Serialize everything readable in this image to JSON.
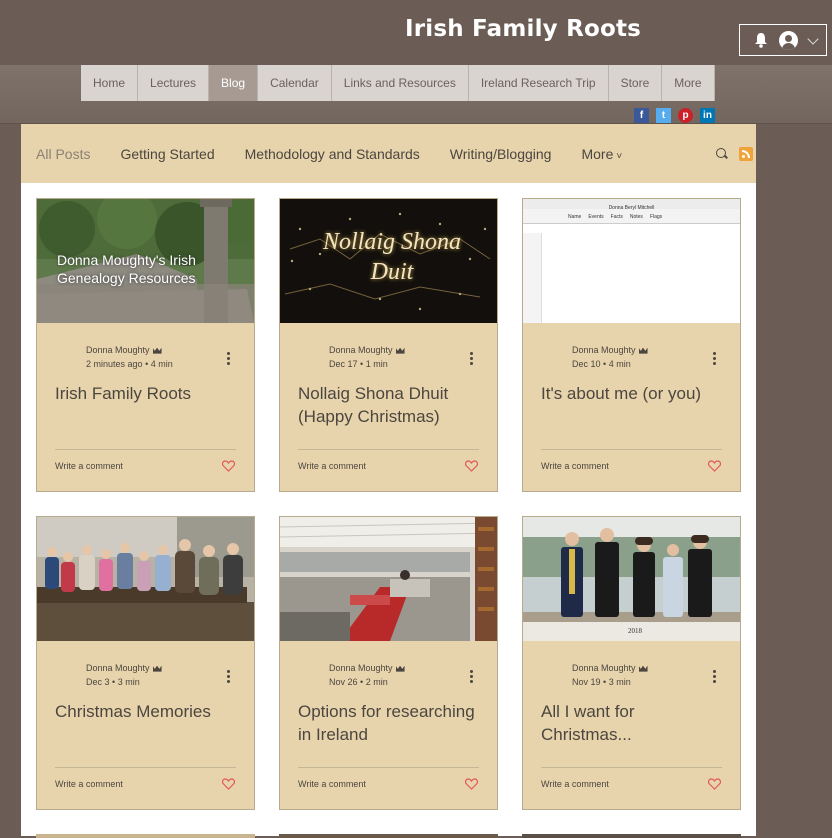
{
  "site": {
    "title": "Irish Family Roots"
  },
  "nav": {
    "items": [
      "Home",
      "Lectures",
      "Blog",
      "Calendar",
      "Links and Resources",
      "Ireland Research Trip",
      "Store",
      "More"
    ],
    "active": "Blog"
  },
  "social": [
    "facebook",
    "twitter",
    "pinterest",
    "linkedin"
  ],
  "blog": {
    "categories": [
      "All Posts",
      "Getting Started",
      "Methodology and Standards",
      "Writing/Blogging",
      "More"
    ],
    "active_category": "All Posts",
    "posts": [
      {
        "author": "Donna Moughty",
        "date": "2 minutes ago",
        "read_time": "4 min",
        "title": "Irish Family Roots",
        "thumb_text": "Donna Moughty's Irish Genealogy Resources"
      },
      {
        "author": "Donna Moughty",
        "date": "Dec 17",
        "read_time": "1 min",
        "title": "Nollaig Shona Dhuit (Happy Christmas)",
        "thumb_text": "Nollaig Shona Duit"
      },
      {
        "author": "Donna Moughty",
        "date": "Dec 10",
        "read_time": "4 min",
        "title": "It's about me (or you)",
        "thumb_text": "Donna Beryl Mitchell",
        "thumb_tabs": [
          "Name",
          "Events",
          "Facts",
          "Notes",
          "Flags"
        ]
      },
      {
        "author": "Donna Moughty",
        "date": "Dec 3",
        "read_time": "3 min",
        "title": "Christmas Memories"
      },
      {
        "author": "Donna Moughty",
        "date": "Nov 26",
        "read_time": "2 min",
        "title": "Options for researching in Ireland"
      },
      {
        "author": "Donna Moughty",
        "date": "Nov 19",
        "read_time": "3 min",
        "title": "All I want for Christmas...",
        "thumb_text": "2018"
      }
    ],
    "write_comment_label": "Write a comment",
    "meta_separator": "•"
  },
  "colors": {
    "header_bg": "#6b5d55",
    "card_bg": "#e8d4ac",
    "heart": "#e05a5a",
    "rss": "#f0a33a",
    "text": "#4b463f"
  }
}
